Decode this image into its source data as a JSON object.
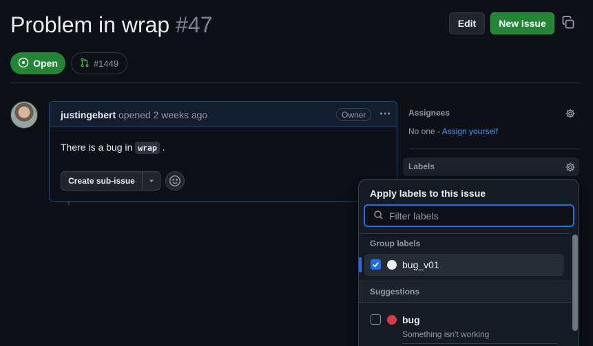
{
  "header": {
    "title": "Problem in wrap",
    "number": "#47",
    "edit_label": "Edit",
    "new_issue_label": "New issue",
    "state": "Open",
    "linked_pr": "#1449"
  },
  "comment": {
    "author": "justingebert",
    "meta": "opened 2 weeks ago",
    "role_badge": "Owner",
    "body_prefix": "There is a bug in",
    "body_code": "wrap",
    "body_suffix": ".",
    "sub_issue_label": "Create sub-issue"
  },
  "sidebar": {
    "assignees_heading": "Assignees",
    "assignees_none": "No one - ",
    "assign_yourself": "Assign yourself",
    "labels_heading": "Labels"
  },
  "label_picker": {
    "title": "Apply labels to this issue",
    "filter_placeholder": "Filter labels",
    "group_heading": "Group labels",
    "group_items": [
      {
        "name": "bug_v01",
        "checked": true,
        "color": "#ededed"
      }
    ],
    "suggestions_heading": "Suggestions",
    "suggestion_items": [
      {
        "name": "bug",
        "description": "Something isn't working",
        "checked": false,
        "color": "#d73a4a"
      }
    ]
  },
  "colors": {
    "accent": "#1f6feb",
    "open_green": "#238636",
    "link": "#4493f8"
  },
  "icons": [
    "copy-icon",
    "issue-open-icon",
    "pull-request-icon",
    "kebab-icon",
    "chevron-down-icon",
    "smiley-icon",
    "gear-icon",
    "search-icon",
    "check-icon"
  ]
}
